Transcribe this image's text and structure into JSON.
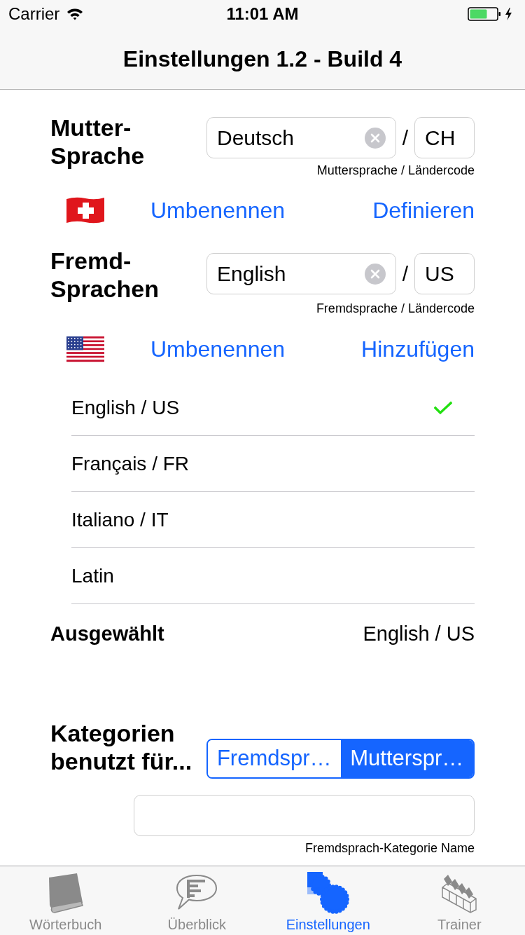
{
  "status_bar": {
    "carrier": "Carrier",
    "time": "11:01 AM"
  },
  "nav_bar": {
    "title": "Einstellungen 1.2 - Build 4"
  },
  "native_language": {
    "label": "Mutter-Sprache",
    "name_field": {
      "value": "Deutsch"
    },
    "separator": "/",
    "code_field": {
      "value": "CH"
    },
    "caption": "Muttersprache / Ländercode",
    "actions": [
      "Umbenennen",
      "Definieren"
    ]
  },
  "foreign_languages": {
    "label": "Fremd-Sprachen",
    "name_field": {
      "value": "English"
    },
    "separator": "/",
    "code_field": {
      "value": "US"
    },
    "caption": "Fremdsprache / Ländercode",
    "actions": [
      "Umbenennen",
      "Hinzufügen"
    ],
    "items": [
      {
        "label": "English / US",
        "selected": true
      },
      {
        "label": "Français / FR",
        "selected": false
      },
      {
        "label": "Italiano / IT",
        "selected": false
      },
      {
        "label": "Latin",
        "selected": false
      }
    ],
    "chosen": {
      "label": "Ausgewählt",
      "value": "English / US"
    }
  },
  "categories": {
    "label": "Kategorien benutzt für...",
    "segments": [
      {
        "label": "Fremdspr…",
        "selected": false
      },
      {
        "label": "Mutterspr…",
        "selected": true
      }
    ],
    "name_field": {
      "caption": "Fremdsprach-Kategorie Name"
    }
  },
  "tab_bar": {
    "tabs": [
      {
        "label": "Wörterbuch",
        "selected": false
      },
      {
        "label": "Überblick",
        "selected": false
      },
      {
        "label": "Einstellungen",
        "selected": true
      },
      {
        "label": "Trainer",
        "selected": false
      }
    ]
  }
}
